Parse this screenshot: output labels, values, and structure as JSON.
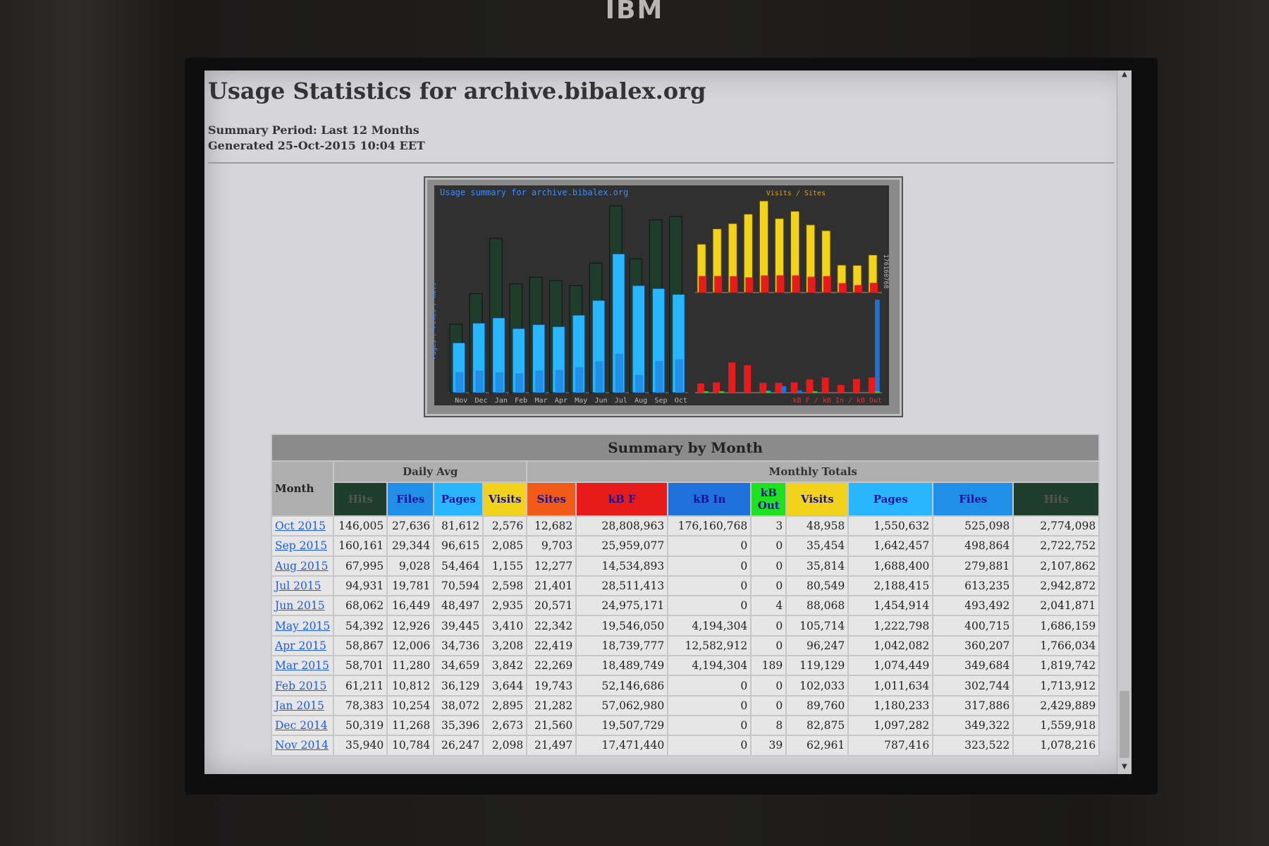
{
  "brand": "IBM",
  "page": {
    "title": "Usage Statistics for archive.bibalex.org",
    "summary_period": "Summary Period: Last 12 Months",
    "generated": "Generated 25-Oct-2015 10:04 EET"
  },
  "colors": {
    "hits": "#1e3d2c",
    "files": "#1f8fe8",
    "pages": "#27b6ff",
    "visits": "#f2d21a",
    "sites": "#f15a17",
    "kbf": "#e81b1b",
    "kbin": "#1f72dc",
    "kbout": "#1ee21e"
  },
  "chart_data": {
    "type": "bar",
    "title": "Usage summary for archive.bibalex.org",
    "categories": [
      "Nov",
      "Dec",
      "Jan",
      "Feb",
      "Mar",
      "Apr",
      "May",
      "Jun",
      "Jul",
      "Aug",
      "Sep",
      "Oct"
    ],
    "left_axis_label": "Pages / Files / Hits",
    "right_top_legend": "Visits / Sites",
    "right_bottom_legend": "kB F / kB In / kB Out",
    "right_axis_max_label": "176160768",
    "series": [
      {
        "name": "Hits",
        "values": [
          1078216,
          1559918,
          2429889,
          1713912,
          1819742,
          1766034,
          1686159,
          2041871,
          2942872,
          2107862,
          2722752,
          2774098
        ]
      },
      {
        "name": "Files",
        "values": [
          323522,
          349322,
          317886,
          302744,
          349684,
          360207,
          400715,
          493492,
          613235,
          279881,
          498864,
          525098
        ]
      },
      {
        "name": "Pages",
        "values": [
          787416,
          1097282,
          1180233,
          1011634,
          1074449,
          1042082,
          1222798,
          1454914,
          2188415,
          1688400,
          1642457,
          1550632
        ]
      },
      {
        "name": "Visits",
        "values": [
          62961,
          82875,
          89760,
          102033,
          119129,
          96247,
          105714,
          88068,
          80549,
          35814,
          35454,
          48958
        ]
      },
      {
        "name": "Sites",
        "values": [
          21497,
          21560,
          21282,
          19743,
          22269,
          22419,
          22342,
          20571,
          21401,
          12277,
          9703,
          12682
        ]
      },
      {
        "name": "kB F",
        "values": [
          17471440,
          19507729,
          57062980,
          52146686,
          18489749,
          18739777,
          19546050,
          24975171,
          28511413,
          14534893,
          25959077,
          28808963
        ]
      },
      {
        "name": "kB In",
        "values": [
          0,
          0,
          0,
          0,
          4194304,
          12582912,
          4194304,
          0,
          0,
          0,
          0,
          176160768
        ]
      },
      {
        "name": "kB Out",
        "values": [
          39,
          8,
          0,
          0,
          189,
          0,
          0,
          4,
          0,
          0,
          0,
          3
        ]
      }
    ]
  },
  "table": {
    "caption": "Summary by Month",
    "month_label": "Month",
    "daily_avg_label": "Daily Avg",
    "monthly_totals_label": "Monthly Totals",
    "headers": [
      "Hits",
      "Files",
      "Pages",
      "Visits",
      "Sites",
      "kB F",
      "kB In",
      "kB Out",
      "Visits",
      "Pages",
      "Files",
      "Hits"
    ],
    "rows": [
      [
        "Oct 2015",
        "146,005",
        "27,636",
        "81,612",
        "2,576",
        "12,682",
        "28,808,963",
        "176,160,768",
        "3",
        "48,958",
        "1,550,632",
        "525,098",
        "2,774,098"
      ],
      [
        "Sep 2015",
        "160,161",
        "29,344",
        "96,615",
        "2,085",
        "9,703",
        "25,959,077",
        "0",
        "0",
        "35,454",
        "1,642,457",
        "498,864",
        "2,722,752"
      ],
      [
        "Aug 2015",
        "67,995",
        "9,028",
        "54,464",
        "1,155",
        "12,277",
        "14,534,893",
        "0",
        "0",
        "35,814",
        "1,688,400",
        "279,881",
        "2,107,862"
      ],
      [
        "Jul 2015",
        "94,931",
        "19,781",
        "70,594",
        "2,598",
        "21,401",
        "28,511,413",
        "0",
        "0",
        "80,549",
        "2,188,415",
        "613,235",
        "2,942,872"
      ],
      [
        "Jun 2015",
        "68,062",
        "16,449",
        "48,497",
        "2,935",
        "20,571",
        "24,975,171",
        "0",
        "4",
        "88,068",
        "1,454,914",
        "493,492",
        "2,041,871"
      ],
      [
        "May 2015",
        "54,392",
        "12,926",
        "39,445",
        "3,410",
        "22,342",
        "19,546,050",
        "4,194,304",
        "0",
        "105,714",
        "1,222,798",
        "400,715",
        "1,686,159"
      ],
      [
        "Apr 2015",
        "58,867",
        "12,006",
        "34,736",
        "3,208",
        "22,419",
        "18,739,777",
        "12,582,912",
        "0",
        "96,247",
        "1,042,082",
        "360,207",
        "1,766,034"
      ],
      [
        "Mar 2015",
        "58,701",
        "11,280",
        "34,659",
        "3,842",
        "22,269",
        "18,489,749",
        "4,194,304",
        "189",
        "119,129",
        "1,074,449",
        "349,684",
        "1,819,742"
      ],
      [
        "Feb 2015",
        "61,211",
        "10,812",
        "36,129",
        "3,644",
        "19,743",
        "52,146,686",
        "0",
        "0",
        "102,033",
        "1,011,634",
        "302,744",
        "1,713,912"
      ],
      [
        "Jan 2015",
        "78,383",
        "10,254",
        "38,072",
        "2,895",
        "21,282",
        "57,062,980",
        "0",
        "0",
        "89,760",
        "1,180,233",
        "317,886",
        "2,429,889"
      ],
      [
        "Dec 2014",
        "50,319",
        "11,268",
        "35,396",
        "2,673",
        "21,560",
        "19,507,729",
        "0",
        "8",
        "82,875",
        "1,097,282",
        "349,322",
        "1,559,918"
      ],
      [
        "Nov 2014",
        "35,940",
        "10,784",
        "26,247",
        "2,098",
        "21,497",
        "17,471,440",
        "0",
        "39",
        "62,961",
        "787,416",
        "323,522",
        "1,078,216"
      ]
    ]
  }
}
